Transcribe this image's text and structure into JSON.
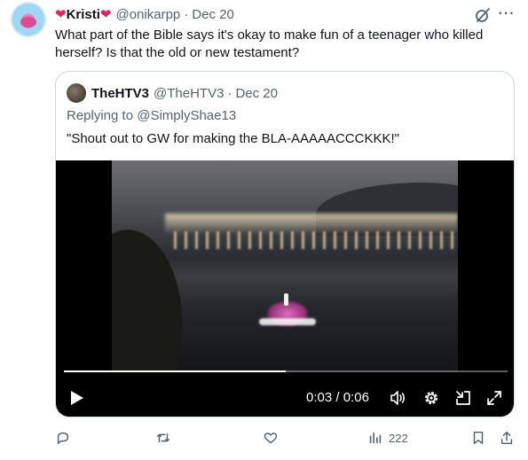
{
  "tweet": {
    "name": "Kristi",
    "handle": "@onikarpp",
    "separator": "·",
    "date": "Dec 20",
    "text": "What part of the Bible says it's okay to make fun of a teenager who killed herself? Is that the old or new testament?",
    "more_label": "···"
  },
  "quote": {
    "name": "TheHTV3",
    "handle": "@TheHTV3",
    "separator": "·",
    "date": "Dec 20",
    "replying_prefix": "Replying to ",
    "replying_to": "@SimplyShae13",
    "text": "\"Shout out to GW for making the BLA-AAAAACCCKKK!\""
  },
  "video": {
    "current_time": "0:03",
    "time_separator": " / ",
    "duration": "0:06",
    "progress_percent": 50
  },
  "actions": {
    "views": "222"
  },
  "icons": [
    "reply-icon",
    "retweet-icon",
    "like-icon",
    "views-icon",
    "bookmark-icon",
    "share-icon",
    "grok-icon",
    "more-icon",
    "play-icon",
    "volume-icon",
    "settings-icon",
    "pip-icon",
    "fullscreen-icon"
  ],
  "colors": {
    "heart": "#e0245e",
    "secondary_text": "#536471",
    "border": "#cfd9de"
  }
}
